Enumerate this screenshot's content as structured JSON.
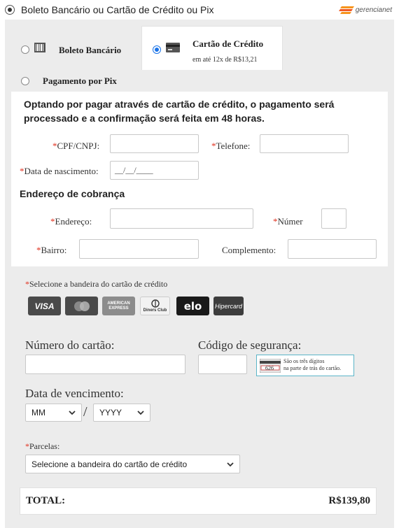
{
  "header": {
    "option_label": "Boleto Bancário ou Cartão de Crédito ou Pix",
    "logo_text": "gerencianet"
  },
  "tabs": {
    "boleto": {
      "label": "Boleto Bancário"
    },
    "cartao": {
      "label": "Cartão de Crédito",
      "sub": "em até 12x de R$13,21"
    },
    "pix": {
      "label": "Pagamento por Pix"
    }
  },
  "notice": "Optando por pagar através de cartão de crédito, o pagamento será processado e a confirmação será feita em 48 horas.",
  "fields": {
    "cpf": "CPF/CNPJ:",
    "telefone": "Telefone:",
    "nascimento": "Data de nascimento:",
    "nascimento_placeholder": "__/__/____",
    "address_heading": "Endereço de cobrança",
    "endereco": "Endereço:",
    "numero": "Númer",
    "bairro": "Bairro:",
    "complemento": "Complemento:",
    "required_mark": "*"
  },
  "card": {
    "brand_label": "Selecione a bandeira do cartão de crédito",
    "brands": [
      "VISA",
      "MasterCard",
      "AMERICAN EXPRESS",
      "Diners Club",
      "elo",
      "Hipercard"
    ],
    "number_label": "Número do cartão:",
    "cvv_label": "Código de segurança:",
    "cvv_example": "626",
    "cvv_hint_line1": "São os três dígitos",
    "cvv_hint_line2": "na parte de trás do cartão.",
    "expiry_label": "Data de vencimento:",
    "month_value": "MM",
    "year_value": "YYYY",
    "separator": "/",
    "installments_label": "Parcelas:",
    "installments_value": "Selecione a bandeira do cartão de crédito"
  },
  "total": {
    "label": "TOTAL:",
    "value": "R$139,80"
  },
  "colors": {
    "accent": "#1a73e8",
    "required": "#e0301e",
    "panel": "#ececec"
  }
}
